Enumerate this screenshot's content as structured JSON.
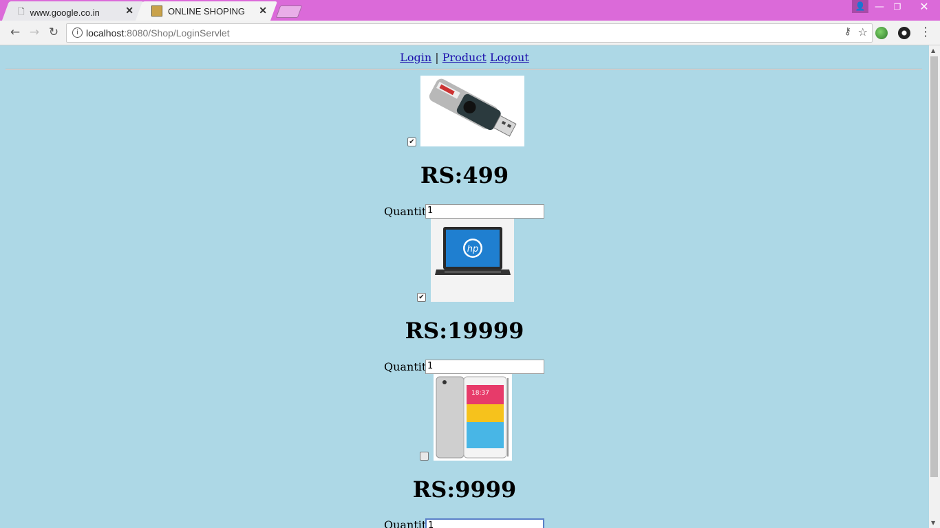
{
  "browser": {
    "tabs": [
      {
        "label": "www.google.co.in"
      },
      {
        "label": "ONLINE SHOPING"
      }
    ],
    "url_host": "localhost",
    "url_rest": ":8080/Shop/LoginServlet"
  },
  "nav": {
    "login": "Login",
    "separator": "|",
    "product": "Product",
    "logout": "Logout"
  },
  "products": [
    {
      "name_icon": "usb-flash-drive-image",
      "checked": true,
      "price": "RS:499",
      "quantity_label": "Quantity:",
      "quantity_value": "1"
    },
    {
      "name_icon": "hp-laptop-image",
      "checked": true,
      "price": "RS:19999",
      "quantity_label": "Quantity:",
      "quantity_value": "1"
    },
    {
      "name_icon": "smartphone-image",
      "checked": false,
      "price": "RS:9999",
      "quantity_label": "Quantity:",
      "quantity_value": "1"
    }
  ],
  "colors": {
    "page_background": "#add8e6",
    "titlebar": "#db6ad9",
    "link": "#1a0dab"
  }
}
